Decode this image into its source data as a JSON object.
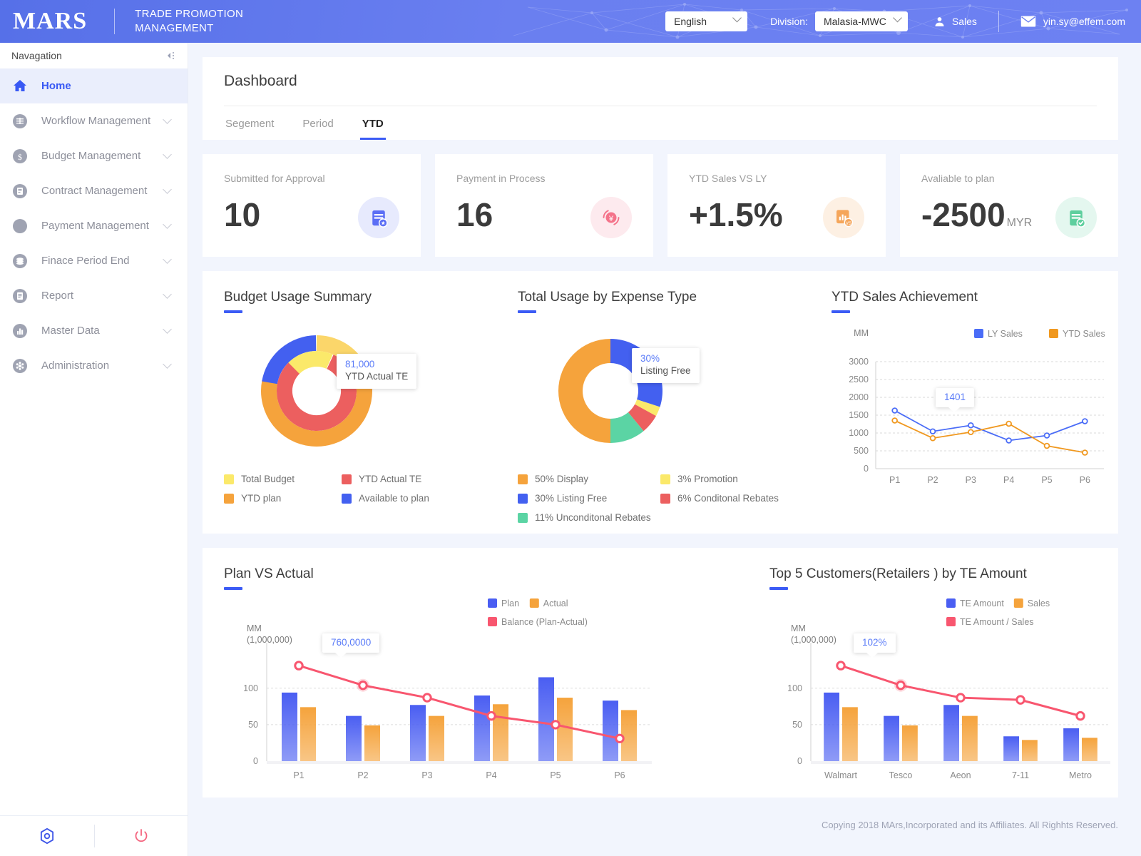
{
  "header": {
    "logo": "MARS",
    "app_title_line1": "TRADE PROMOTION",
    "app_title_line2": "MANAGEMENT",
    "language": "English",
    "division_label": "Division:",
    "division": "Malasia-MWC",
    "user_role": "Sales",
    "email": "yin.sy@effem.com"
  },
  "sidebar": {
    "title": "Navagation",
    "items": [
      {
        "label": "Home",
        "icon": "home-icon",
        "active": true,
        "expandable": false
      },
      {
        "label": "Workflow Management",
        "icon": "workflow-icon",
        "active": false,
        "expandable": true
      },
      {
        "label": "Budget Management",
        "icon": "budget-icon",
        "active": false,
        "expandable": true
      },
      {
        "label": "Contract Management",
        "icon": "contract-icon",
        "active": false,
        "expandable": true
      },
      {
        "label": "Payment Management",
        "icon": "payment-icon",
        "active": false,
        "expandable": true
      },
      {
        "label": "Finace Period End",
        "icon": "finance-icon",
        "active": false,
        "expandable": true
      },
      {
        "label": "Report",
        "icon": "report-icon",
        "active": false,
        "expandable": true
      },
      {
        "label": "Master Data",
        "icon": "master-data-icon",
        "active": false,
        "expandable": true
      },
      {
        "label": "Administration",
        "icon": "administration-icon",
        "active": false,
        "expandable": true
      }
    ],
    "footer_icons": [
      "settings-icon",
      "power-icon"
    ]
  },
  "dashboard": {
    "title": "Dashboard",
    "tabs": [
      {
        "label": "Segement",
        "active": false
      },
      {
        "label": "Period",
        "active": false
      },
      {
        "label": "YTD",
        "active": true
      }
    ]
  },
  "kpis": [
    {
      "label": "Submitted for Approval",
      "value": "10",
      "unit": "",
      "icon": "clipboard-add-icon",
      "color": "#5b6ef5",
      "bg": "#e7eafd"
    },
    {
      "label": "Payment in Process",
      "value": "16",
      "unit": "",
      "icon": "yen-refresh-icon",
      "color": "#f4738a",
      "bg": "#fdeaee"
    },
    {
      "label": "YTD Sales VS LY",
      "value": "+1.5%",
      "unit": "",
      "icon": "chart-vs-icon",
      "color": "#f5a65b",
      "bg": "#fdf0e3"
    },
    {
      "label": "Avaliable to plan",
      "value": "-2500",
      "unit": "MYR",
      "icon": "clipboard-check-icon",
      "color": "#5ecf9e",
      "bg": "#e4f7ef"
    }
  ],
  "charts": {
    "budget_usage": {
      "title": "Budget Usage Summary",
      "tooltip_value": "81,000",
      "tooltip_label": "YTD Actual TE",
      "legend": [
        {
          "label": "Total Budget",
          "color": "#fbe96a"
        },
        {
          "label": "YTD Actual TE",
          "color": "#ec5f5f"
        },
        {
          "label": "YTD plan",
          "color": "#f5a33c"
        },
        {
          "label": "Available to plan",
          "color": "#4360f0"
        }
      ]
    },
    "expense_type": {
      "title": "Total Usage by Expense Type",
      "tooltip_value": "30%",
      "tooltip_label": "Listing Free",
      "legend": [
        {
          "label": "50% Display",
          "color": "#f5a33c"
        },
        {
          "label": "3% Promotion",
          "color": "#fbe96a"
        },
        {
          "label": "30% Listing Free",
          "color": "#4360f0"
        },
        {
          "label": "6% Conditonal Rebates",
          "color": "#ec5f5f"
        },
        {
          "label": "11% Unconditonal Rebates",
          "color": "#5bd4a4"
        }
      ]
    },
    "ytd_sales": {
      "title": "YTD Sales Achievement",
      "tooltip_value": "1401"
    },
    "plan_vs_actual": {
      "title": "Plan  VS  Actual",
      "tooltip_value": "760,0000"
    },
    "top5": {
      "title": "Top 5 Customers(Retailers ) by TE Amount",
      "tooltip_value": "102%"
    }
  },
  "chart_data": [
    {
      "id": "budget_usage",
      "type": "pie",
      "title": "Budget Usage Summary",
      "subtype": "nested-donut",
      "outer_ring": [
        {
          "name": "Total Budget",
          "value": 14,
          "color": "#fbd66a"
        },
        {
          "name": "YTD plan",
          "value": 64,
          "color": "#f5a33c"
        },
        {
          "name": "Available to plan",
          "value": 22,
          "color": "#4360f0"
        }
      ],
      "inner_ring": [
        {
          "name": "YTD Actual TE",
          "value": 81,
          "color": "#ec5f5f"
        },
        {
          "name": "Total Budget",
          "value": 19,
          "color": "#fbe96a"
        }
      ],
      "annotation": "81,000 YTD Actual TE"
    },
    {
      "id": "expense_type",
      "type": "pie",
      "title": "Total Usage by Expense Type",
      "categories": [
        "Display",
        "Listing Free",
        "Promotion",
        "Conditonal Rebates",
        "Unconditonal Rebates"
      ],
      "values": [
        50,
        30,
        3,
        6,
        11
      ],
      "colors": [
        "#f5a33c",
        "#4360f0",
        "#fbe96a",
        "#ec5f5f",
        "#5bd4a4"
      ],
      "annotation": "30% Listing Free"
    },
    {
      "id": "ytd_sales",
      "type": "line",
      "title": "YTD Sales Achievement",
      "ylabel": "MM",
      "xlabel": "",
      "categories": [
        "P1",
        "P2",
        "P3",
        "P4",
        "P5",
        "P6"
      ],
      "yticks": [
        0,
        500,
        1000,
        1500,
        2000,
        2500,
        3000
      ],
      "ylim": [
        0,
        3000
      ],
      "grid": true,
      "legend_position": "top-right",
      "series": [
        {
          "name": "LY Sales",
          "color": "#4a6cf7",
          "values": [
            1630,
            1045,
            1215,
            790,
            930,
            1330
          ]
        },
        {
          "name": "YTD Sales",
          "color": "#f0981f",
          "values": [
            1350,
            855,
            1025,
            1260,
            640,
            450
          ]
        }
      ],
      "annotation": "1401"
    },
    {
      "id": "plan_vs_actual",
      "type": "bar",
      "title": "Plan  VS  Actual",
      "ylabel": "MM\n(1,000,000)",
      "categories": [
        "P1",
        "P2",
        "P3",
        "P4",
        "P5",
        "P6"
      ],
      "yticks": [
        0,
        50,
        100
      ],
      "ylim": [
        0,
        135
      ],
      "grid": true,
      "legend_position": "top-right",
      "series": [
        {
          "name": "Plan",
          "type": "bar",
          "color": "#4a5ef2",
          "values": [
            94,
            62,
            77,
            90,
            115,
            83
          ]
        },
        {
          "name": "Actual",
          "type": "bar",
          "color": "#f5a33c",
          "values": [
            74,
            49,
            62,
            78,
            87,
            70
          ]
        },
        {
          "name": "Balance  (Plan-Actual)",
          "type": "line",
          "color": "#f8566f",
          "values": [
            131,
            104,
            87,
            62,
            50,
            31
          ]
        }
      ],
      "annotation": "760,0000"
    },
    {
      "id": "top5",
      "type": "bar",
      "title": "Top 5 Customers(Retailers ) by TE Amount",
      "ylabel": "MM\n(1,000,000)",
      "categories": [
        "Walmart",
        "Tesco",
        "Aeon",
        "7-11",
        "Metro"
      ],
      "yticks": [
        0,
        50,
        100
      ],
      "ylim": [
        0,
        135
      ],
      "grid": true,
      "legend_position": "top-right",
      "series": [
        {
          "name": "TE Amount",
          "type": "bar",
          "color": "#4a5ef2",
          "values": [
            94,
            62,
            77,
            34,
            45
          ]
        },
        {
          "name": "Sales",
          "type": "bar",
          "color": "#f5a33c",
          "values": [
            74,
            49,
            62,
            29,
            32
          ]
        },
        {
          "name": "TE Amount / Sales",
          "type": "line",
          "color": "#f8566f",
          "values": [
            131,
            104,
            87,
            84,
            62
          ]
        }
      ],
      "annotation": "102%"
    }
  ],
  "footer": {
    "copyright": "Copying 2018 MArs,Incorporated and its Affiliates. All Righhts Reserved."
  }
}
